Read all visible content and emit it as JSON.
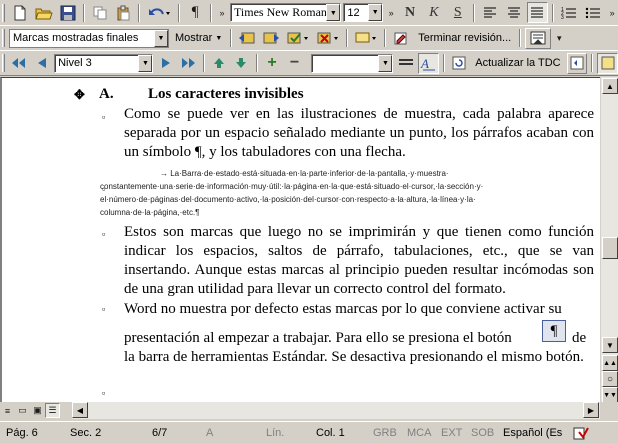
{
  "toolbar1": {
    "font_name": "Times New Roman",
    "font_size": "12",
    "bold": "N",
    "italic": "K",
    "underline": "S",
    "pilcrow": "¶"
  },
  "toolbar2": {
    "markup_view": "Marcas mostradas finales",
    "show_label": "Mostrar",
    "end_review": "Terminar revisión..."
  },
  "toolbar3": {
    "outline_level": "Nivel 3",
    "update_toc": "Actualizar la TDC"
  },
  "document": {
    "heading_letter": "A.",
    "heading_title": "Los caracteres invisibles",
    "para1": "Como se puede ver en las ilustraciones de muestra, cada palabra aparece separada por un espacio señalado mediante un punto, los párrafos acaban con un símbolo ¶, y los tabuladores con una flecha.",
    "para2_l1": "→       La·Barra·de·estado·está·situada·en·la·parte·inferior·de·la·pantalla,·y·muestra·",
    "para2_l2": "constantemente·una·serie·de·información·muy·útil:·la·página·en·la·que·está·situado·el·cursor,·la·sección·y·",
    "para2_l3": "el·número·de·páginas·del·documento·activo,·la·posición·del·cursor·con·respecto·a·la·altura,·la·línea·y·la·",
    "para2_l4": "columna·de·la·página,·etc.¶",
    "para3": "Estos son marcas que luego no se imprimirán y que tienen como función indicar los espacios, saltos de párrafo, tabulaciones, etc., que se van insertando. Aunque estas marcas al principio pueden resultar incómodas son de una gran utilidad para llevar un correcto control del formato.",
    "para4_l1": "Word no muestra por defecto estas marcas por lo que conviene activar su",
    "para4_l2a": "presentación al empezar a trabajar. Para ello se presiona el botón",
    "para4_l2b": "de",
    "para4_rest": "la barra de herramientas Estándar. Se desactiva presionando el mismo botón.",
    "inline_pilcrow": "¶"
  },
  "statusbar": {
    "page": "Pág. 6",
    "section": "Sec. 2",
    "pages": "6/7",
    "at": "A",
    "line": "Lín.",
    "col": "Col. 1",
    "grb": "GRB",
    "mca": "MCA",
    "ext": "EXT",
    "sob": "SOB",
    "language": "Español (Es"
  }
}
